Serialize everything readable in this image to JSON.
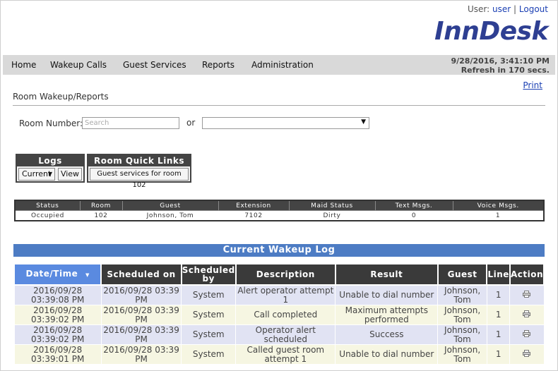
{
  "header": {
    "user_prefix": "User:",
    "user_name": "user",
    "separator": "|",
    "logout_label": "Logout",
    "logo_text": "InnDesk"
  },
  "nav": {
    "items": [
      "Home",
      "Wakeup Calls",
      "Guest Services",
      "Reports",
      "Administration"
    ],
    "datetime": "9/28/2016, 3:41:10 PM",
    "refresh": "Refresh in 170 secs."
  },
  "page": {
    "print_label": "Print",
    "section_title": "Room Wakeup/Reports",
    "room_number_label": "Room Number:",
    "room_number_placeholder": "Search",
    "or_label": "or",
    "room_select_value": ""
  },
  "logs_box": {
    "title": "Logs",
    "select_value": "Current",
    "view_label": "View"
  },
  "quick_links_box": {
    "title": "Room Quick Links",
    "button_label": "Guest services for room 102"
  },
  "status_table": {
    "headers": [
      "Status",
      "Room",
      "Guest",
      "Extension",
      "Maid Status",
      "Text Msgs.",
      "Voice Msgs."
    ],
    "row": [
      "Occupied",
      "102",
      "Johnson, Tom",
      "7102",
      "Dirty",
      "0",
      "1"
    ]
  },
  "wakeup_log": {
    "title": "Current Wakeup Log",
    "headers": [
      "Date/Time",
      "Scheduled on",
      "Scheduled by",
      "Description",
      "Result",
      "Guest",
      "Line",
      "Action"
    ],
    "rows": [
      [
        "2016/09/28 03:39:08 PM",
        "2016/09/28 03:39 PM",
        "System",
        "Alert operator attempt 1",
        "Unable to dial number",
        "Johnson, Tom",
        "1"
      ],
      [
        "2016/09/28 03:39:02 PM",
        "2016/09/28 03:39 PM",
        "System",
        "Call completed",
        "Maximum attempts performed",
        "Johnson, Tom",
        "1"
      ],
      [
        "2016/09/28 03:39:02 PM",
        "2016/09/28 03:39 PM",
        "System",
        "Operator alert scheduled",
        "Success",
        "Johnson, Tom",
        "1"
      ],
      [
        "2016/09/28 03:39:01 PM",
        "2016/09/28 03:39 PM",
        "System",
        "Called guest room attempt 1",
        "Unable to dial number",
        "Johnson, Tom",
        "1"
      ]
    ],
    "action_icon": "print-icon"
  },
  "colors": {
    "logo": "#2e3f92",
    "link": "#1a3fb3",
    "log_title_bg": "#4d7cc4",
    "sorted_header_bg": "#5a8ae0",
    "odd_row_bg": "#e1e3f3",
    "even_row_bg": "#f6f6e2"
  }
}
